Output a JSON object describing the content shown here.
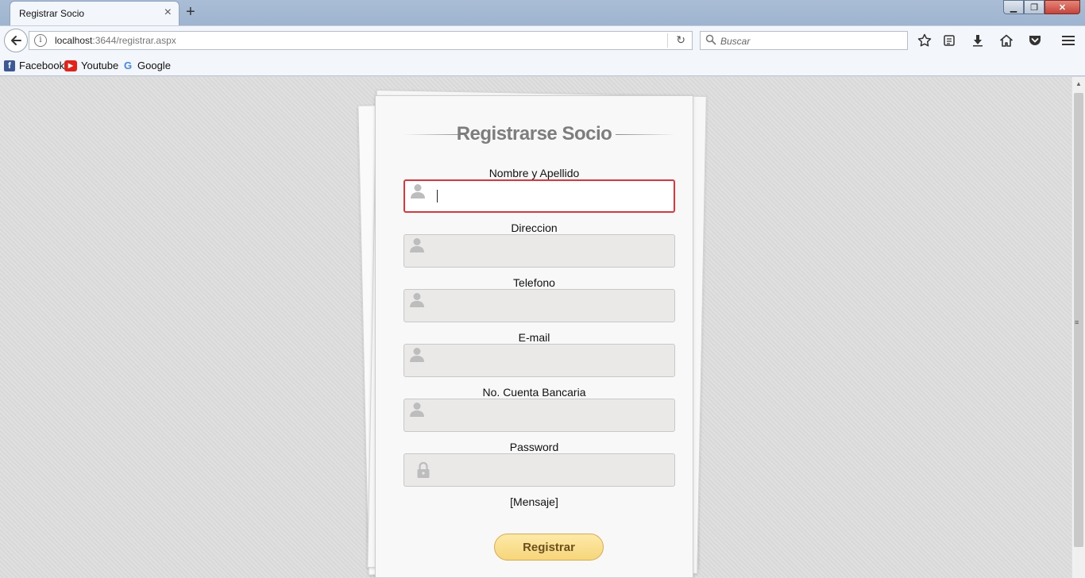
{
  "browser": {
    "tab_title": "Registrar Socio",
    "tab_close": "×",
    "new_tab": "+",
    "window_controls": {
      "minimize": "▁",
      "maximize": "❐",
      "close": "✕"
    },
    "url_host": "localhost",
    "url_rest": ":3644/registrar.aspx",
    "info_icon": "i",
    "reload_icon": "↻",
    "search_placeholder": "Buscar",
    "toolbar_icons": [
      "star-icon",
      "reading-list-icon",
      "download-icon",
      "home-icon",
      "pocket-icon",
      "menu-icon"
    ],
    "bookmarks": [
      {
        "label": "Facebook",
        "icon": "f",
        "color": "#3b5998"
      },
      {
        "label": "Youtube",
        "icon": "▶",
        "color": "#e62117"
      },
      {
        "label": "Google",
        "icon": "G",
        "color": "#4285f4"
      }
    ]
  },
  "form": {
    "title": "Registrarse Socio",
    "fields": [
      {
        "label": "Nombre y Apellido",
        "value": "",
        "icon": "user-icon",
        "focused": true
      },
      {
        "label": "Direccion",
        "value": "",
        "icon": "user-icon",
        "focused": false
      },
      {
        "label": "Telefono",
        "value": "",
        "icon": "user-icon",
        "focused": false
      },
      {
        "label": "E-mail",
        "value": "",
        "icon": "user-icon",
        "focused": false
      },
      {
        "label": "No. Cuenta Bancaria",
        "value": "",
        "icon": "user-icon",
        "focused": false
      },
      {
        "label": "Password",
        "value": "",
        "icon": "lock-icon",
        "focused": false
      }
    ],
    "message": "[Mensaje]",
    "submit_label": "Registrar"
  },
  "colors": {
    "focus_border": "#e0363a",
    "button_fill": "#f7d67a",
    "title_text": "#7d7d7d"
  }
}
